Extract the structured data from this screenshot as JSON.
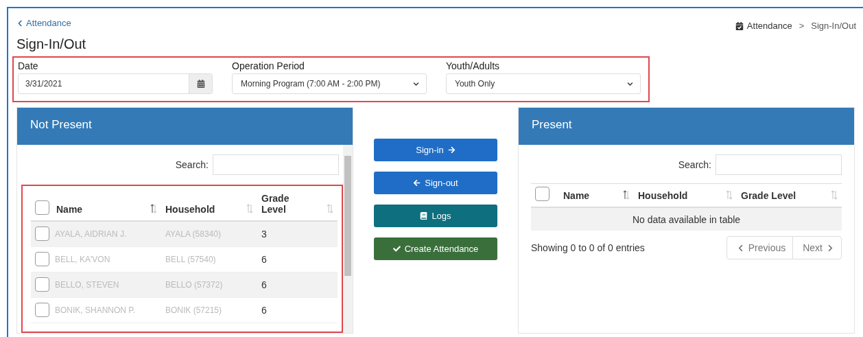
{
  "back_link": {
    "label": "Attendance"
  },
  "page_title": "Sign-In/Out",
  "breadcrumb": {
    "section": "Attendance",
    "separator": ">",
    "current": "Sign-In/Out"
  },
  "filters": {
    "date": {
      "label": "Date",
      "value": "3/31/2021"
    },
    "operation_period": {
      "label": "Operation Period",
      "value": "Morning Program (7:00 AM - 2:00 PM)"
    },
    "youth_adults": {
      "label": "Youth/Adults",
      "value": "Youth Only"
    }
  },
  "not_present": {
    "title": "Not Present",
    "search_label": "Search:",
    "columns": [
      {
        "label": "Name"
      },
      {
        "label": "Household"
      },
      {
        "label": "Grade Level"
      }
    ],
    "select_all_checked": false,
    "rows": [
      {
        "name": "AYALA, AIDRIAN J.",
        "household": "AYALA (58340)",
        "grade": "3",
        "checked": false
      },
      {
        "name": "BELL, KA'VON",
        "household": "BELL (57540)",
        "grade": "6",
        "checked": false
      },
      {
        "name": "BELLO, STEVEN",
        "household": "BELLO (57372)",
        "grade": "6",
        "checked": false
      },
      {
        "name": "BONIK, SHANNON P.",
        "household": "BONIK (57215)",
        "grade": "6",
        "checked": false
      }
    ]
  },
  "actions": [
    {
      "label": "Sign-in",
      "kind": "sign-in"
    },
    {
      "label": "Sign-out",
      "kind": "sign-out"
    },
    {
      "label": "Logs",
      "kind": "logs"
    },
    {
      "label": "Create Attendance",
      "kind": "create"
    }
  ],
  "present": {
    "title": "Present",
    "search_label": "Search:",
    "columns": [
      {
        "label": "Name"
      },
      {
        "label": "Household"
      },
      {
        "label": "Grade Level"
      }
    ],
    "select_all_checked": false,
    "empty_message": "No data available in table",
    "info": "Showing 0 to 0 of 0 entries",
    "pagination": {
      "previous": "Previous",
      "next": "Next"
    }
  }
}
